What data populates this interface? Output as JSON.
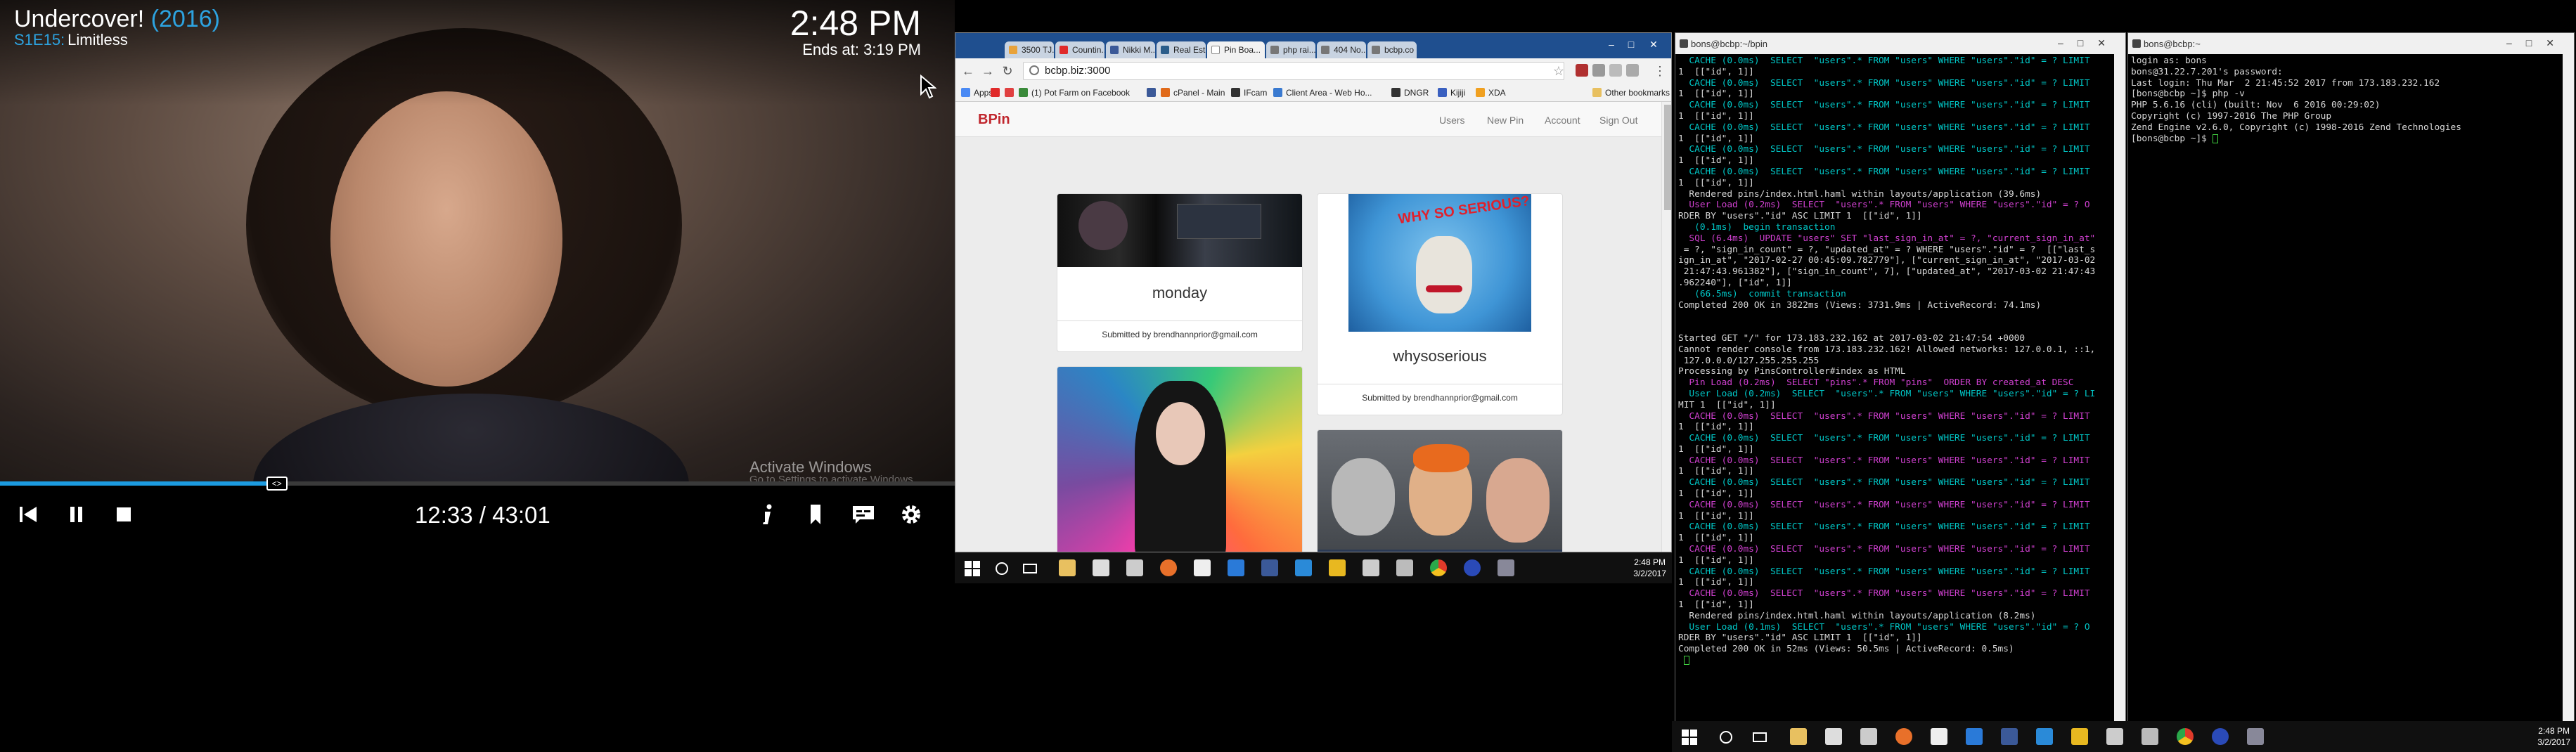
{
  "video": {
    "show_title": "Undercover!",
    "year_open": " (",
    "year": "2016",
    "year_close": ")",
    "episode_code": "S1E15:",
    "episode_title": "Limitless",
    "clock": "2:48 PM",
    "ends_at": "Ends at: 3:19 PM",
    "elapsed": "12:33",
    "total": "43:01",
    "progress_fraction": 0.29,
    "watermark_title": "Activate Windows",
    "watermark_sub": "Go to Settings to activate Windows.",
    "controls": [
      "skip-back",
      "pause",
      "stop",
      "info",
      "bookmark",
      "subtitles",
      "settings"
    ],
    "accent_color": "#1c9be0"
  },
  "browser": {
    "tabs": [
      {
        "label": "3500 TJ...",
        "icon_color": "#e8a23a"
      },
      {
        "label": "Countin...",
        "icon_color": "#e02a2a"
      },
      {
        "label": "Nikki M...",
        "icon_color": "#3b5998"
      },
      {
        "label": "Real Est...",
        "icon_color": "#2b5d8a"
      },
      {
        "label": "Pin Boa...",
        "icon_color": "#dddddd",
        "active": true
      },
      {
        "label": "php rai...",
        "icon_color": "#777777"
      },
      {
        "label": "404 No...",
        "icon_color": "#777777"
      },
      {
        "label": "bcbp.co",
        "icon_color": "#777777"
      }
    ],
    "url": "bcbp.biz:3000",
    "bookmarks": [
      {
        "label": "Apps",
        "color": "#4a8af4"
      },
      {
        "label": "",
        "color": "#e02a2a"
      },
      {
        "label": "",
        "color": "#e04040"
      },
      {
        "label": "(1) Pot Farm on Facebook",
        "color": "#3a8a3a"
      },
      {
        "label": "",
        "color": "#3b5998"
      },
      {
        "label": "cPanel - Main",
        "color": "#e06a1a"
      },
      {
        "label": "IFcam",
        "color": "#333333"
      },
      {
        "label": "Client Area - Web Ho...",
        "color": "#3a7ad0"
      },
      {
        "label": "DNGR",
        "color": "#333333"
      },
      {
        "label": "Kijiji",
        "color": "#3a60c0"
      },
      {
        "label": "XDA",
        "color": "#f0a020"
      }
    ],
    "other_bookmarks": "Other bookmarks",
    "app": {
      "brand": "BPin",
      "nav": [
        "Users",
        "New Pin",
        "Account",
        "Sign Out"
      ],
      "pins": [
        {
          "title": "monday",
          "submitted": "Submitted by brendhannprior@gmail.com"
        },
        {
          "title": "whysoserious",
          "submitted": "Submitted by brendhannprior@gmail.com"
        },
        {
          "title": "",
          "submitted": ""
        },
        {
          "title": "",
          "submitted": ""
        }
      ]
    },
    "taskbar_clock": {
      "time": "2:48 PM",
      "date": "3/2/2017"
    }
  },
  "terminal_left": {
    "title": "bons@bcbp:~/bpin",
    "lines": [
      {
        "t": "  CACHE (0.0ms)  SELECT  \"users\".* FROM \"users\" WHERE \"users\".\"id\" = ? LIMIT",
        "c": "cy"
      },
      {
        "t": "1  [[\"id\", 1]]",
        "c": ""
      },
      {
        "t": "  CACHE (0.0ms)  SELECT  \"users\".* FROM \"users\" WHERE \"users\".\"id\" = ? LIMIT",
        "c": "cy"
      },
      {
        "t": "1  [[\"id\", 1]]",
        "c": ""
      },
      {
        "t": "  CACHE (0.0ms)  SELECT  \"users\".* FROM \"users\" WHERE \"users\".\"id\" = ? LIMIT",
        "c": "cy"
      },
      {
        "t": "1  [[\"id\", 1]]",
        "c": ""
      },
      {
        "t": "  CACHE (0.0ms)  SELECT  \"users\".* FROM \"users\" WHERE \"users\".\"id\" = ? LIMIT",
        "c": "cy"
      },
      {
        "t": "1  [[\"id\", 1]]",
        "c": ""
      },
      {
        "t": "  CACHE (0.0ms)  SELECT  \"users\".* FROM \"users\" WHERE \"users\".\"id\" = ? LIMIT",
        "c": "cy"
      },
      {
        "t": "1  [[\"id\", 1]]",
        "c": ""
      },
      {
        "t": "  CACHE (0.0ms)  SELECT  \"users\".* FROM \"users\" WHERE \"users\".\"id\" = ? LIMIT",
        "c": "cy"
      },
      {
        "t": "1  [[\"id\", 1]]",
        "c": ""
      },
      {
        "t": "  Rendered pins/index.html.haml within layouts/application (39.6ms)",
        "c": ""
      },
      {
        "t": "  User Load (0.2ms)  SELECT  \"users\".* FROM \"users\" WHERE \"users\".\"id\" = ? O",
        "c": "mg"
      },
      {
        "t": "RDER BY \"users\".\"id\" ASC LIMIT 1  [[\"id\", 1]]",
        "c": ""
      },
      {
        "t": "   (0.1ms)  begin transaction",
        "c": "cy"
      },
      {
        "t": "  SQL (6.4ms)  UPDATE \"users\" SET \"last_sign_in_at\" = ?, \"current_sign_in_at\"",
        "c": "mg"
      },
      {
        "t": " = ?, \"sign_in_count\" = ?, \"updated_at\" = ? WHERE \"users\".\"id\" = ?  [[\"last_s",
        "c": ""
      },
      {
        "t": "ign_in_at\", \"2017-02-27 00:45:09.782779\"], [\"current_sign_in_at\", \"2017-03-02",
        "c": ""
      },
      {
        "t": " 21:47:43.961382\"], [\"sign_in_count\", 7], [\"updated_at\", \"2017-03-02 21:47:43",
        "c": ""
      },
      {
        "t": ".962240\"], [\"id\", 1]]",
        "c": ""
      },
      {
        "t": "   (66.5ms)  commit transaction",
        "c": "cy"
      },
      {
        "t": "Completed 200 OK in 3822ms (Views: 3731.9ms | ActiveRecord: 74.1ms)",
        "c": ""
      },
      {
        "t": "",
        "c": ""
      },
      {
        "t": "",
        "c": ""
      },
      {
        "t": "Started GET \"/\" for 173.183.232.162 at 2017-03-02 21:47:54 +0000",
        "c": ""
      },
      {
        "t": "Cannot render console from 173.183.232.162! Allowed networks: 127.0.0.1, ::1,",
        "c": ""
      },
      {
        "t": " 127.0.0.0/127.255.255.255",
        "c": ""
      },
      {
        "t": "Processing by PinsController#index as HTML",
        "c": ""
      },
      {
        "t": "  Pin Load (0.2ms)  SELECT \"pins\".* FROM \"pins\"  ORDER BY created_at DESC",
        "c": "mg"
      },
      {
        "t": "  User Load (0.2ms)  SELECT  \"users\".* FROM \"users\" WHERE \"users\".\"id\" = ? LI",
        "c": "cy"
      },
      {
        "t": "MIT 1  [[\"id\", 1]]",
        "c": ""
      },
      {
        "t": "  CACHE (0.0ms)  SELECT  \"users\".* FROM \"users\" WHERE \"users\".\"id\" = ? LIMIT",
        "c": "mg"
      },
      {
        "t": "1  [[\"id\", 1]]",
        "c": ""
      },
      {
        "t": "  CACHE (0.0ms)  SELECT  \"users\".* FROM \"users\" WHERE \"users\".\"id\" = ? LIMIT",
        "c": "cy"
      },
      {
        "t": "1  [[\"id\", 1]]",
        "c": ""
      },
      {
        "t": "  CACHE (0.0ms)  SELECT  \"users\".* FROM \"users\" WHERE \"users\".\"id\" = ? LIMIT",
        "c": "mg"
      },
      {
        "t": "1  [[\"id\", 1]]",
        "c": ""
      },
      {
        "t": "  CACHE (0.0ms)  SELECT  \"users\".* FROM \"users\" WHERE \"users\".\"id\" = ? LIMIT",
        "c": "cy"
      },
      {
        "t": "1  [[\"id\", 1]]",
        "c": ""
      },
      {
        "t": "  CACHE (0.0ms)  SELECT  \"users\".* FROM \"users\" WHERE \"users\".\"id\" = ? LIMIT",
        "c": "mg"
      },
      {
        "t": "1  [[\"id\", 1]]",
        "c": ""
      },
      {
        "t": "  CACHE (0.0ms)  SELECT  \"users\".* FROM \"users\" WHERE \"users\".\"id\" = ? LIMIT",
        "c": "cy"
      },
      {
        "t": "1  [[\"id\", 1]]",
        "c": ""
      },
      {
        "t": "  CACHE (0.0ms)  SELECT  \"users\".* FROM \"users\" WHERE \"users\".\"id\" = ? LIMIT",
        "c": "mg"
      },
      {
        "t": "1  [[\"id\", 1]]",
        "c": ""
      },
      {
        "t": "  CACHE (0.0ms)  SELECT  \"users\".* FROM \"users\" WHERE \"users\".\"id\" = ? LIMIT",
        "c": "cy"
      },
      {
        "t": "1  [[\"id\", 1]]",
        "c": ""
      },
      {
        "t": "  CACHE (0.0ms)  SELECT  \"users\".* FROM \"users\" WHERE \"users\".\"id\" = ? LIMIT",
        "c": "mg"
      },
      {
        "t": "1  [[\"id\", 1]]",
        "c": ""
      },
      {
        "t": "  Rendered pins/index.html.haml within layouts/application (8.2ms)",
        "c": ""
      },
      {
        "t": "  User Load (0.1ms)  SELECT  \"users\".* FROM \"users\" WHERE \"users\".\"id\" = ? O",
        "c": "cy"
      },
      {
        "t": "RDER BY \"users\".\"id\" ASC LIMIT 1  [[\"id\", 1]]",
        "c": ""
      },
      {
        "t": "Completed 200 OK in 52ms (Views: 50.5ms | ActiveRecord: 0.5ms)",
        "c": ""
      },
      {
        "t": "",
        "c": ""
      }
    ]
  },
  "terminal_right": {
    "title": "bons@bcbp:~",
    "lines": [
      {
        "t": "login as: bons",
        "c": ""
      },
      {
        "t": "bons@31.22.7.201's password:",
        "c": ""
      },
      {
        "t": "Last login: Thu Mar  2 21:45:52 2017 from 173.183.232.162",
        "c": ""
      },
      {
        "t": "[bons@bcbp ~]$ php -v",
        "c": ""
      },
      {
        "t": "PHP 5.6.16 (cli) (built: Nov  6 2016 00:29:02)",
        "c": ""
      },
      {
        "t": "Copyright (c) 1997-2016 The PHP Group",
        "c": ""
      },
      {
        "t": "Zend Engine v2.6.0, Copyright (c) 1998-2016 Zend Technologies",
        "c": ""
      },
      {
        "t": "[bons@bcbp ~]$ ",
        "c": ""
      }
    ]
  },
  "taskbar3_clock": {
    "time": "2:48 PM",
    "date": "3/2/2017"
  }
}
